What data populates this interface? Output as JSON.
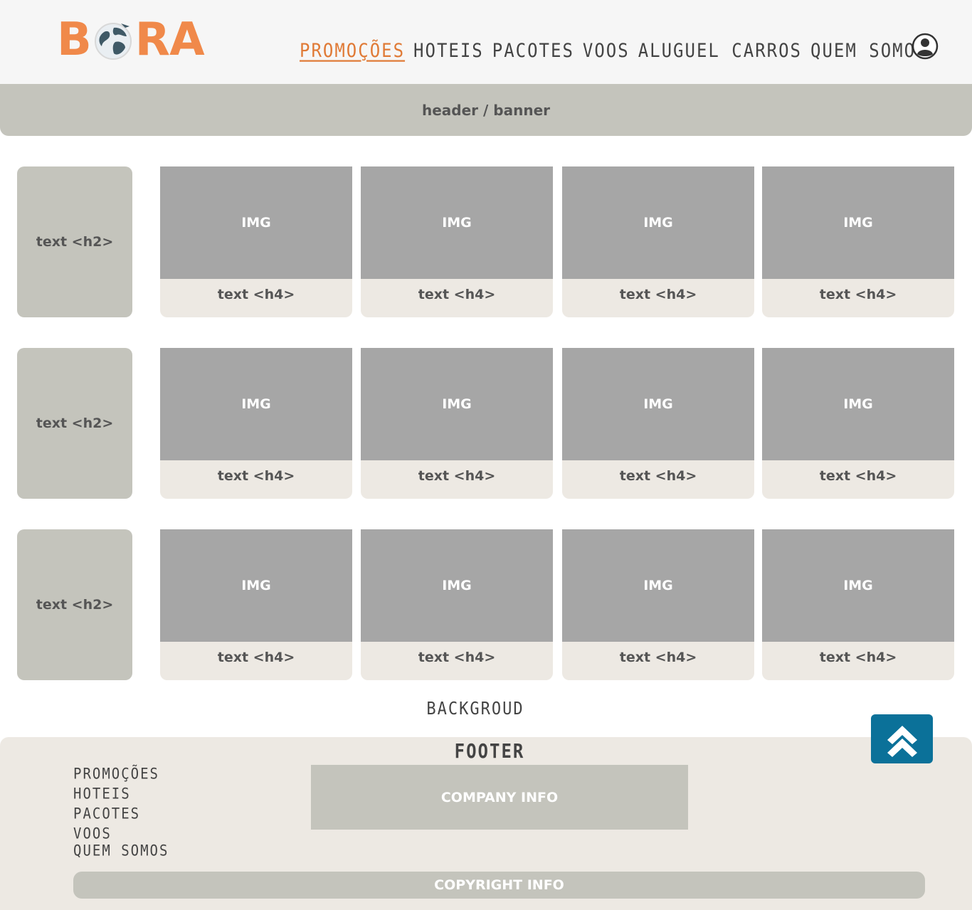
{
  "brand": {
    "logo_letters": [
      "B",
      "RA"
    ],
    "color": "#f0894a"
  },
  "nav": {
    "items": [
      {
        "label": "PROMOÇÕES",
        "active": true
      },
      {
        "label": "HOTEIS"
      },
      {
        "label": "PACOTES"
      },
      {
        "label": "VOOS"
      },
      {
        "label": "ALUGUEL CARROS"
      },
      {
        "label": "QUEM SOMOS"
      }
    ],
    "user_icon": "user-circle-icon"
  },
  "banner": {
    "label": "header / banner"
  },
  "rows": [
    {
      "title": "text <h2>",
      "cards": [
        {
          "img": "IMG",
          "label": "text <h4>"
        },
        {
          "img": "IMG",
          "label": "text <h4>"
        },
        {
          "img": "IMG",
          "label": "text <h4>"
        },
        {
          "img": "IMG",
          "label": "text <h4>"
        }
      ]
    },
    {
      "title": "text <h2>",
      "cards": [
        {
          "img": "IMG",
          "label": "text <h4>"
        },
        {
          "img": "IMG",
          "label": "text <h4>"
        },
        {
          "img": "IMG",
          "label": "text <h4>"
        },
        {
          "img": "IMG",
          "label": "text <h4>"
        }
      ]
    },
    {
      "title": "text <h2>",
      "cards": [
        {
          "img": "IMG",
          "label": "text <h4>"
        },
        {
          "img": "IMG",
          "label": "text <h4>"
        },
        {
          "img": "IMG",
          "label": "text <h4>"
        },
        {
          "img": "IMG",
          "label": "text <h4>"
        }
      ]
    }
  ],
  "background_label": "BACKGROUD",
  "footer": {
    "title": "FOOTER",
    "links": [
      "PROMOÇÕES",
      "HOTEIS",
      "PACOTES",
      "VOOS",
      "QUEM SOMOS"
    ],
    "company": "COMPANY INFO",
    "copyright": "COPYRIGHT INFO"
  },
  "back_to_top": {
    "icon": "double-chevron-up-icon",
    "color": "#0b7199"
  }
}
